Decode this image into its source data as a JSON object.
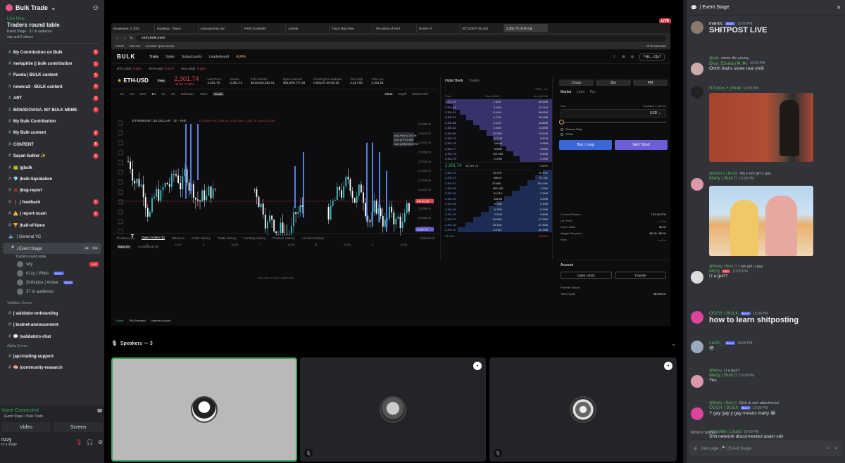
{
  "sidebar": {
    "server_name": "Bulk Trade",
    "live_now": "Live Now",
    "stage_title": "Traders round table",
    "stage_meta": "Event Stage · 37 in audience",
    "stage_people": "sdy and 2 others",
    "channels": [
      {
        "label": "My Contribution on Bulk",
        "badge": "1",
        "bold": true
      },
      {
        "label": "melophile || bulk contribution",
        "badge": "1",
        "bold": true
      },
      {
        "label": "Panda | BULK content",
        "badge": "1",
        "bold": true
      },
      {
        "label": "nowera3 - BULK content",
        "badge": "3",
        "bold": true
      },
      {
        "label": "ART",
        "badge": "3",
        "bold": true
      },
      {
        "label": "BENADOVIGA. MY BULK MEME",
        "badge": "1",
        "bold": true
      },
      {
        "label": "My Bulk Contribution",
        "badge": "",
        "bold": true
      },
      {
        "label": "My Bulk content",
        "badge": "2",
        "bold": true
      },
      {
        "label": "CONTENT",
        "badge": "6",
        "bold": true
      },
      {
        "label": "Sayan bulker ✨",
        "badge": "1",
        "bold": true
      },
      {
        "label": "🐸 |gbulk",
        "badge": "",
        "bold": true
      },
      {
        "label": "💎 |bulk-liquidation",
        "badge": "",
        "bold": true
      },
      {
        "label": "🐞 |bug-report",
        "badge": "",
        "bold": true
      },
      {
        "label": "❗ | feedback",
        "badge": "1",
        "bold": true
      },
      {
        "label": "⚠️ | report-scam",
        "badge": "2",
        "bold": true
      },
      {
        "label": "🏆 |hall-of-fame",
        "badge": "",
        "bold": true
      },
      {
        "label": "| General VC",
        "badge": "",
        "bold": false
      }
    ],
    "active_stage": {
      "label": "| Event Stage",
      "count_a": "40",
      "count_b": "720",
      "sub": "Traders round table"
    },
    "stage_users": [
      {
        "name": "sdy",
        "tag": "LIVE"
      },
      {
        "name": "rizzy | Vibes",
        "tag": "BULK"
      },
      {
        "name": "Orthodox | Active",
        "tag": "BULK"
      },
      {
        "name": "37 in audience",
        "tag": ""
      }
    ],
    "cat_validator": "Validator Corner",
    "validator_channels": [
      "| validator-onboarding",
      "| testnet-annoucement",
      "💬 |validators-chat"
    ],
    "cat_alpha": "Alpha Corner",
    "alpha_channels": [
      "|api-trading-support",
      "🧠 |community-research"
    ],
    "voice": {
      "status": "Voice Connected",
      "sub": "Event Stage / Bulk Trade",
      "video": "Video",
      "screen": "Screen",
      "user": "rizzy",
      "user_sub": "In a stage"
    }
  },
  "browser": {
    "tabs": [
      "Входящие (1 303)",
      "перевод - Поиск",
      "калькулятор онл",
      "Feed | LinkedIn",
      "Joyride",
      "Tuyo | Buy Now",
      "The allure of lend",
      "Home / X",
      "BTCUSDT 80,283",
      "2,301.73 | ETH | B"
    ],
    "url": "early.bulk.trade",
    "bookmarks": [
      "Gmail",
      "Discord",
      "онлайн-транслитер"
    ],
    "all_bookmarks": "All Bookmarks",
    "live": "LIVE"
  },
  "app": {
    "logo": "BULK",
    "nav": [
      "Trade",
      "Stake",
      "Subaccounts",
      "Leaderboard"
    ],
    "aura": "AURA",
    "account": "74jk...LQp7",
    "tickers": [
      {
        "s": "BTC-USD",
        "c": "-0.65%"
      },
      {
        "s": "ETH-USD",
        "c": "-0.41%"
      },
      {
        "s": "SOL-USD",
        "c": "-0.91%"
      }
    ],
    "symbol": "ETH-USD",
    "perp": "Perp",
    "price": "2,301.74",
    "price_chg": "-11.20 -0.48%",
    "stats": [
      {
        "k": "Last Price",
        "v": "2,301.75"
      },
      {
        "k": "Oracle",
        "v": "2,301.74"
      },
      {
        "k": "24h Volume",
        "v": "$215,818,392.01"
      },
      {
        "k": "Open Interest",
        "v": "$46,009,777.28"
      },
      {
        "k": "Funding/Countdown",
        "v": "0.0011% 00:50:18"
      },
      {
        "k": "24h High",
        "v": "2,317.50"
      },
      {
        "k": "24h Low",
        "v": "2,301.61"
      }
    ],
    "timeframes": [
      "1m",
      "5m",
      "15m",
      "1H",
      "4H",
      "1D"
    ],
    "indicators": "Indicators",
    "mark": "Mark",
    "oracle": "Oracle",
    "chart_tabs": [
      "Chart",
      "Depth",
      "Market Info"
    ],
    "chart_title": "ETHEREUM / US DOLLAR · 1h · Pyth",
    "ohlc": "O 2,308.07  H 2,309.18  L 2,301.36  C 2,301.76  -6.25 (-0.27%)",
    "tooltip": [
      "Avg. Price  $2,301.96",
      "Sum (ETH)  5.99K",
      "Sum (USDC)  $13.79M"
    ],
    "price_tag": "2,301.74",
    "pm_tag": "PM 00:56",
    "bottom_tabs": [
      "Positions (1)",
      "Open Orders (0)",
      "Balances",
      "Order History",
      "Trade History",
      "Funding History",
      "Position History",
      "Account History"
    ],
    "basic": "Basic (0)",
    "conditional": "Conditional (0)",
    "cancel_all": "Cancel All",
    "empty": "You have no open orders yet.",
    "status": [
      "Online",
      "PM Standard",
      "Master Account"
    ],
    "orderbook_tabs": [
      "Order Book",
      "Trades"
    ],
    "ob_unit": "USD · 0.1",
    "ob_headers": [
      "Price",
      "Size (USD)",
      "Sum (USD)"
    ],
    "asks": [
      [
        "2,301.95",
        "2.83M",
        "46.96M"
      ],
      [
        "2,301.94",
        "3.16M",
        "42.11M"
      ],
      [
        "2,301.93",
        "8.61M",
        "38.63M"
      ],
      [
        "2,301.91",
        "4.17M",
        "30.03M"
      ],
      [
        "2,301.88",
        "3.01M",
        "25.86M"
      ],
      [
        "2,301.82",
        "2.93M",
        "22.85M"
      ],
      [
        "2,301.80",
        "13.25M",
        "19.92M"
      ],
      [
        "2,301.79",
        "2.71M",
        "6.67M"
      ],
      [
        "2,301.78",
        "0.81M",
        "3.96M"
      ],
      [
        "2,301.77",
        "3.95M",
        "3.59M"
      ],
      [
        "2,301.75",
        "421.69K",
        "3.59M"
      ],
      [
        "2,301.75",
        "2.23M",
        "2.23M"
      ]
    ],
    "spread": "2,301.74",
    "spread_b": "$2,301.75",
    "spread_c": "0.00%",
    "bids": [
      [
        "2,301.73",
        "92.07K",
        "92.07K"
      ],
      [
        "2,301.71",
        "405.31",
        "97.11K"
      ],
      [
        "2,301.67",
        "23.83K",
        "115.44K"
      ],
      [
        "2,301.58",
        "963.49K",
        "1.25M"
      ],
      [
        "2,301.50",
        "94.01K",
        "1.34M"
      ],
      [
        "2,301.49",
        "285.53",
        "3.29M"
      ],
      [
        "2,301.48",
        "5.29M",
        "4.19M"
      ],
      [
        "2,301.38",
        "8.79M",
        "6.79M"
      ],
      [
        "2,301.35",
        "3.01M",
        "9.89M"
      ],
      [
        "2,301.20",
        "19.08M",
        "37.55M"
      ],
      [
        "2,301.18",
        "20.16K",
        "37.55M"
      ],
      [
        "2,301.00",
        "8.01M",
        "45.78M"
      ]
    ],
    "ob_foot": [
      "51.00%",
      "48.98%"
    ],
    "trade": {
      "modes": [
        "Cross",
        "35x",
        "PM"
      ],
      "types": [
        "Market",
        "Limit",
        "Pro"
      ],
      "size_label": "Size",
      "available": "Available  1,959.26",
      "unit": "USD",
      "reduce_only": "Reduce Only",
      "tpsl": "TP/SL",
      "buy": "Buy / Long",
      "sell": "Sell / Short",
      "info": [
        [
          "Current Position",
          "123.16 ETH"
        ],
        [
          "Liq. Price",
          "— / —"
        ],
        [
          "Order Value",
          "$0.00"
        ],
        [
          "Margin Required",
          "$0.00 / $0.00"
        ],
        [
          "Fees",
          "— / —"
        ]
      ],
      "account": "Account",
      "claim": "Claim USDC",
      "transfer": "Transfer",
      "margin": "Portfolio Margin",
      "equity_label": "Total Equity",
      "equity": "$8,963.91"
    }
  },
  "speakers": {
    "label": "Speakers — 3"
  },
  "chat": {
    "title": "| Event Stage",
    "messages": [
      {
        "name": "manoc",
        "tag": "BULK",
        "time": "10:09 PM",
        "text": "SHITPOST LIVE",
        "big": true
      },
      {
        "reply_user": "@sdy",
        "reply": "some die young",
        "name": "Dice_Ebuka (❖,❖)",
        "time": "10:09 PM",
        "text": "Ohhh that's some real shiiii"
      },
      {
        "name": "iTzVirus • | Bulk",
        "time": "10:09 PM",
        "text": ""
      },
      {
        "reply_user": "@OGGY | BULK",
        "reply": "No y not girl y gay",
        "name": "Matty | Bulk 0",
        "time": "10:09 PM",
        "text": ""
      },
      {
        "reply_user": "@Matty | Bulk 0",
        "reply": "I am girl u gay",
        "name": "Morg",
        "tag": "RED",
        "time": "10:09 PM",
        "text": "U a gurl?"
      },
      {
        "name": "OGGY | BULK",
        "tag": "BULK",
        "time": "10:09 PM",
        "text": "how to learn shitposting",
        "big": true
      },
      {
        "name": "LeOn_",
        "tag": "BULK",
        "time": "10:09 PM",
        "text": "😳"
      },
      {
        "reply_user": "@Morg",
        "reply": "U a gurl?",
        "name": "Matty | Bulk 0",
        "time": "10:09 PM",
        "text": "Yes"
      },
      {
        "reply_user": "@Matty | Bulk 0",
        "reply": "Click to see attachment",
        "name": "OGGY | BULK",
        "tag": "BULK",
        "time": "10:09 PM",
        "text": "Y gay gay y gay means matty 😂"
      },
      {
        "name": "Abdullah_Liquid",
        "time": "10:09 PM",
        "text": "Shit network disconnected again sdy"
      }
    ],
    "typing": "Morg is typing...",
    "placeholder": "Message 🎤 | Event Stage"
  },
  "colors": {
    "accent": "#5865f2",
    "green": "#2ebd85",
    "red": "#e0464b",
    "live": "#da373c",
    "gold": "#e5a54b"
  }
}
